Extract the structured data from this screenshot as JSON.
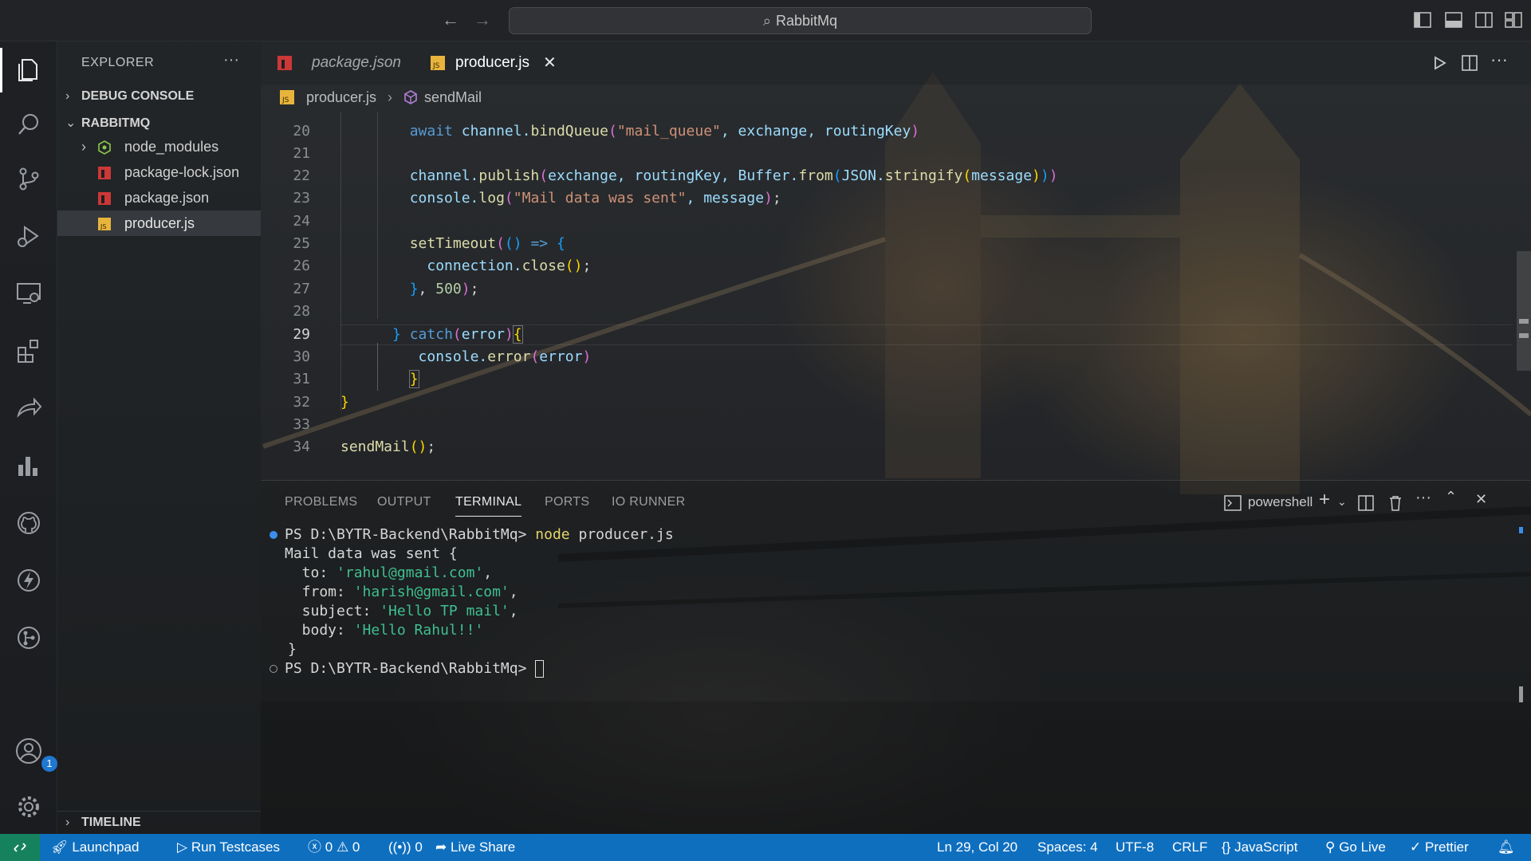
{
  "titlebar": {
    "search_text": "RabbitMq"
  },
  "activity": {
    "accounts_badge": "1"
  },
  "sidebar": {
    "title": "EXPLORER",
    "more": "···",
    "sections": {
      "debug_console": "DEBUG CONSOLE",
      "project": "RABBITMQ",
      "timeline": "TIMELINE"
    },
    "files": [
      {
        "name": "node_modules",
        "type": "folder"
      },
      {
        "name": "package-lock.json",
        "type": "json"
      },
      {
        "name": "package.json",
        "type": "json"
      },
      {
        "name": "producer.js",
        "type": "js",
        "selected": true
      }
    ]
  },
  "tabs": [
    {
      "label": "package.json",
      "active": false
    },
    {
      "label": "producer.js",
      "active": true
    }
  ],
  "breadcrumb": {
    "file": "producer.js",
    "symbol": "sendMail"
  },
  "editor": {
    "line_numbers": [
      "20",
      "21",
      "22",
      "23",
      "24",
      "25",
      "26",
      "27",
      "28",
      "29",
      "30",
      "31",
      "32",
      "33",
      "34"
    ],
    "current_line": "29",
    "code": {
      "l20_kw": "await",
      "l20_obj": "channel.",
      "l20_fn": "bindQueue",
      "l20_str": "\"mail_queue\"",
      "l20_rest": ", exchange, routingKey",
      "l22_obj": "channel.",
      "l22_fn": "publish",
      "l22_args": "exchange, routingKey, Buffer.",
      "l22_fn2": "from",
      "l22_json": "JSON.",
      "l22_fn3": "stringify",
      "l22_msg": "message",
      "l23_obj": "console.",
      "l23_fn": "log",
      "l23_str": "\"Mail data was sent\"",
      "l23_rest": ", message",
      "l25_fn": "setTimeout",
      "l25_arrow": "=>",
      "l26_obj": "connection.",
      "l26_fn": "close",
      "l27_num": "500",
      "l29_kw": "catch",
      "l29_arg": "error",
      "l30_obj": "console.",
      "l30_fn": "error",
      "l30_arg": "error",
      "l34_fn": "sendMail"
    }
  },
  "panel": {
    "tabs": [
      "PROBLEMS",
      "OUTPUT",
      "TERMINAL",
      "PORTS",
      "IO RUNNER"
    ],
    "active_tab": "TERMINAL",
    "shell": "powershell",
    "terminal": {
      "prompt1": "PS D:\\BYTR-Backend\\RabbitMq> ",
      "cmd1_node": "node",
      "cmd1_rest": " producer.js",
      "out_header": "Mail data was sent {",
      "to_key": "  to: ",
      "to_val": "'rahul@gmail.com'",
      "from_key": "  from: ",
      "from_val": "'harish@gmail.com'",
      "subject_key": "  subject: ",
      "subject_val": "'Hello TP mail'",
      "body_key": "  body: ",
      "body_val": "'Hello Rahul!!'",
      "out_close": "}",
      "prompt2": "PS D:\\BYTR-Backend\\RabbitMq> "
    }
  },
  "statusbar": {
    "launchpad": "Launchpad",
    "run_testcases": "Run Testcases",
    "errors": "0",
    "warnings": "0",
    "ports": "0",
    "live_share": "Live Share",
    "position": "Ln 29, Col 20",
    "spaces": "Spaces: 4",
    "encoding": "UTF-8",
    "eol": "CRLF",
    "language": "JavaScript",
    "go_live": "Go Live",
    "prettier": "Prettier"
  },
  "colors": {
    "accent": "#0f6fbf",
    "remote": "#16825d",
    "keyword": "#569cd6",
    "function": "#dcdcaa",
    "string": "#ce9178",
    "terminal_string": "#3fbf8e"
  }
}
